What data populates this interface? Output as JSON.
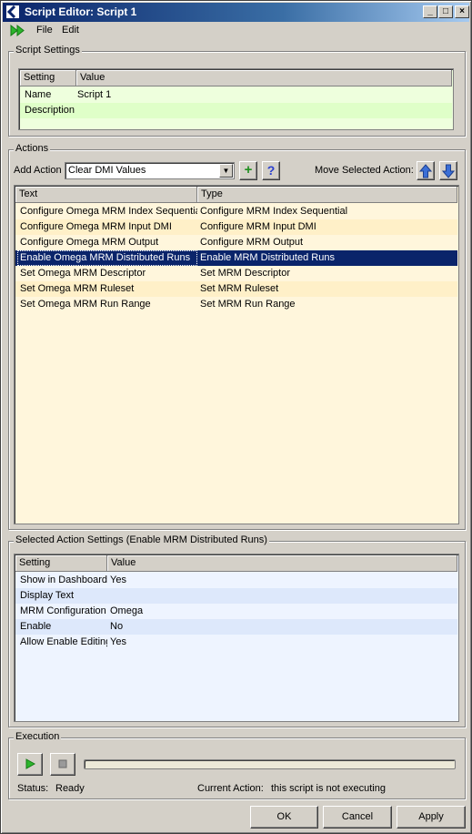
{
  "window": {
    "title": "Script Editor: Script 1",
    "minimize_glyph": "_",
    "maximize_glyph": "□",
    "close_glyph": "×"
  },
  "menu": {
    "items": [
      {
        "label": "File"
      },
      {
        "label": "Edit"
      }
    ],
    "run_icon": "fast-forward-green-icon"
  },
  "script_settings": {
    "group_title": "Script Settings",
    "columns": [
      "Setting",
      "Value"
    ],
    "rows": [
      {
        "setting": "Name",
        "value": "Script 1"
      },
      {
        "setting": "Description",
        "value": ""
      }
    ]
  },
  "actions": {
    "group_title": "Actions",
    "add_action_label": "Add Action",
    "add_action_value": "Clear DMI Values",
    "move_selected_label": "Move Selected Action:",
    "add_icon": "plus-icon",
    "help_icon": "help-icon",
    "add_glyph": "+",
    "help_glyph": "?",
    "move_up_icon": "arrow-up-icon",
    "move_down_icon": "arrow-down-icon",
    "columns": [
      "Text",
      "Type"
    ],
    "rows": [
      {
        "text": "Configure Omega MRM Index Sequential",
        "type": "Configure MRM Index Sequential"
      },
      {
        "text": "Configure Omega MRM Input DMI",
        "type": "Configure MRM Input DMI"
      },
      {
        "text": "Configure Omega MRM Output",
        "type": "Configure MRM Output"
      },
      {
        "text": "Enable Omega MRM Distributed Runs",
        "type": "Enable MRM Distributed Runs"
      },
      {
        "text": "Set Omega MRM Descriptor",
        "type": "Set MRM Descriptor"
      },
      {
        "text": "Set Omega MRM Ruleset",
        "type": "Set MRM Ruleset"
      },
      {
        "text": "Set Omega MRM Run Range",
        "type": "Set MRM Run Range"
      }
    ],
    "selected_index": 3
  },
  "selected_action_settings": {
    "group_title": "Selected Action Settings (Enable MRM Distributed Runs)",
    "columns": [
      "Setting",
      "Value"
    ],
    "rows": [
      {
        "setting": "Show in Dashboard",
        "value": "Yes"
      },
      {
        "setting": "Display Text",
        "value": ""
      },
      {
        "setting": "MRM Configuration",
        "value": "Omega"
      },
      {
        "setting": "Enable",
        "value": "No"
      },
      {
        "setting": "Allow Enable Editing",
        "value": "Yes"
      }
    ]
  },
  "execution": {
    "group_title": "Execution",
    "play_icon": "play-icon",
    "stop_icon": "stop-icon",
    "progress": 0,
    "status_label": "Status:",
    "status_value": "Ready",
    "current_action_label": "Current Action:",
    "current_action_value": "this script is not executing"
  },
  "footer": {
    "ok": "OK",
    "cancel": "Cancel",
    "apply": "Apply"
  },
  "colors": {
    "title_bar": "#0a246a",
    "script_settings_bg": "#eeffdd",
    "script_settings_alt": "#dfffc8",
    "actions_bg": "#fff6dc",
    "actions_alt": "#fff0c8",
    "selection": "#0a246a",
    "selected_settings_bg": "#eef4ff",
    "selected_settings_alt": "#dde8fb"
  }
}
